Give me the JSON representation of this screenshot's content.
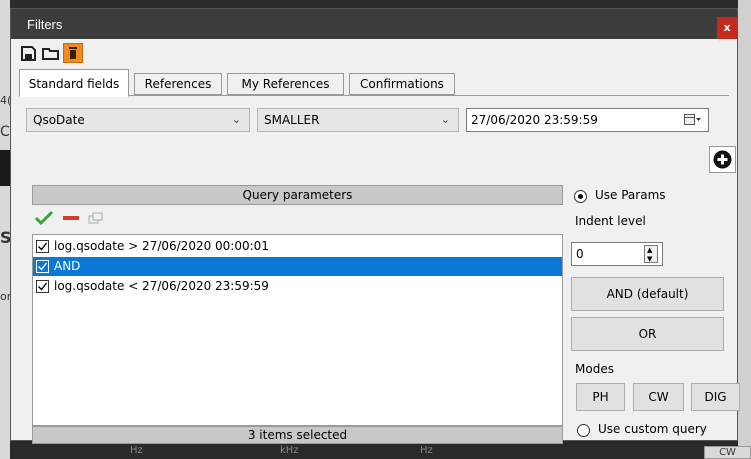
{
  "window": {
    "title": "Filters",
    "close_label": "x"
  },
  "tabs": [
    {
      "label": "Standard fields",
      "active": true
    },
    {
      "label": "References",
      "active": false
    },
    {
      "label": "My References",
      "active": false
    },
    {
      "label": "Confirmations",
      "active": false
    }
  ],
  "filter": {
    "field_select": "QsoDate",
    "operator_select": "SMALLER",
    "date_value": "27/06/2020 23:59:59"
  },
  "query": {
    "header": "Query parameters",
    "rows": [
      {
        "text": "log.qsodate > 27/06/2020 00:00:01",
        "checked": true,
        "selected": false
      },
      {
        "text": "AND",
        "checked": true,
        "selected": true
      },
      {
        "text": "log.qsodate < 27/06/2020 23:59:59",
        "checked": true,
        "selected": false
      }
    ],
    "status": "3 items selected"
  },
  "right_panel": {
    "use_params_label": "Use Params",
    "indent_label": "Indent level",
    "indent_value": "0",
    "and_button": "AND (default)",
    "or_button": "OR",
    "modes_label": "Modes",
    "modes": [
      "PH",
      "CW",
      "DIG"
    ],
    "custom_query_label": "Use custom query"
  },
  "background": {
    "left_fragments": [
      "4(",
      "C",
      "S",
      "or"
    ],
    "bottom_labels": [
      "Hz",
      "kHz",
      "Hz"
    ],
    "cw_tab": "CW"
  },
  "colors": {
    "title_bar": "#3c3c3c",
    "close": "#c42b1c",
    "selection": "#0a78d7",
    "delete_button": "#f28a1e",
    "check_green": "#3aa63a",
    "minus_red": "#d33b2f"
  }
}
